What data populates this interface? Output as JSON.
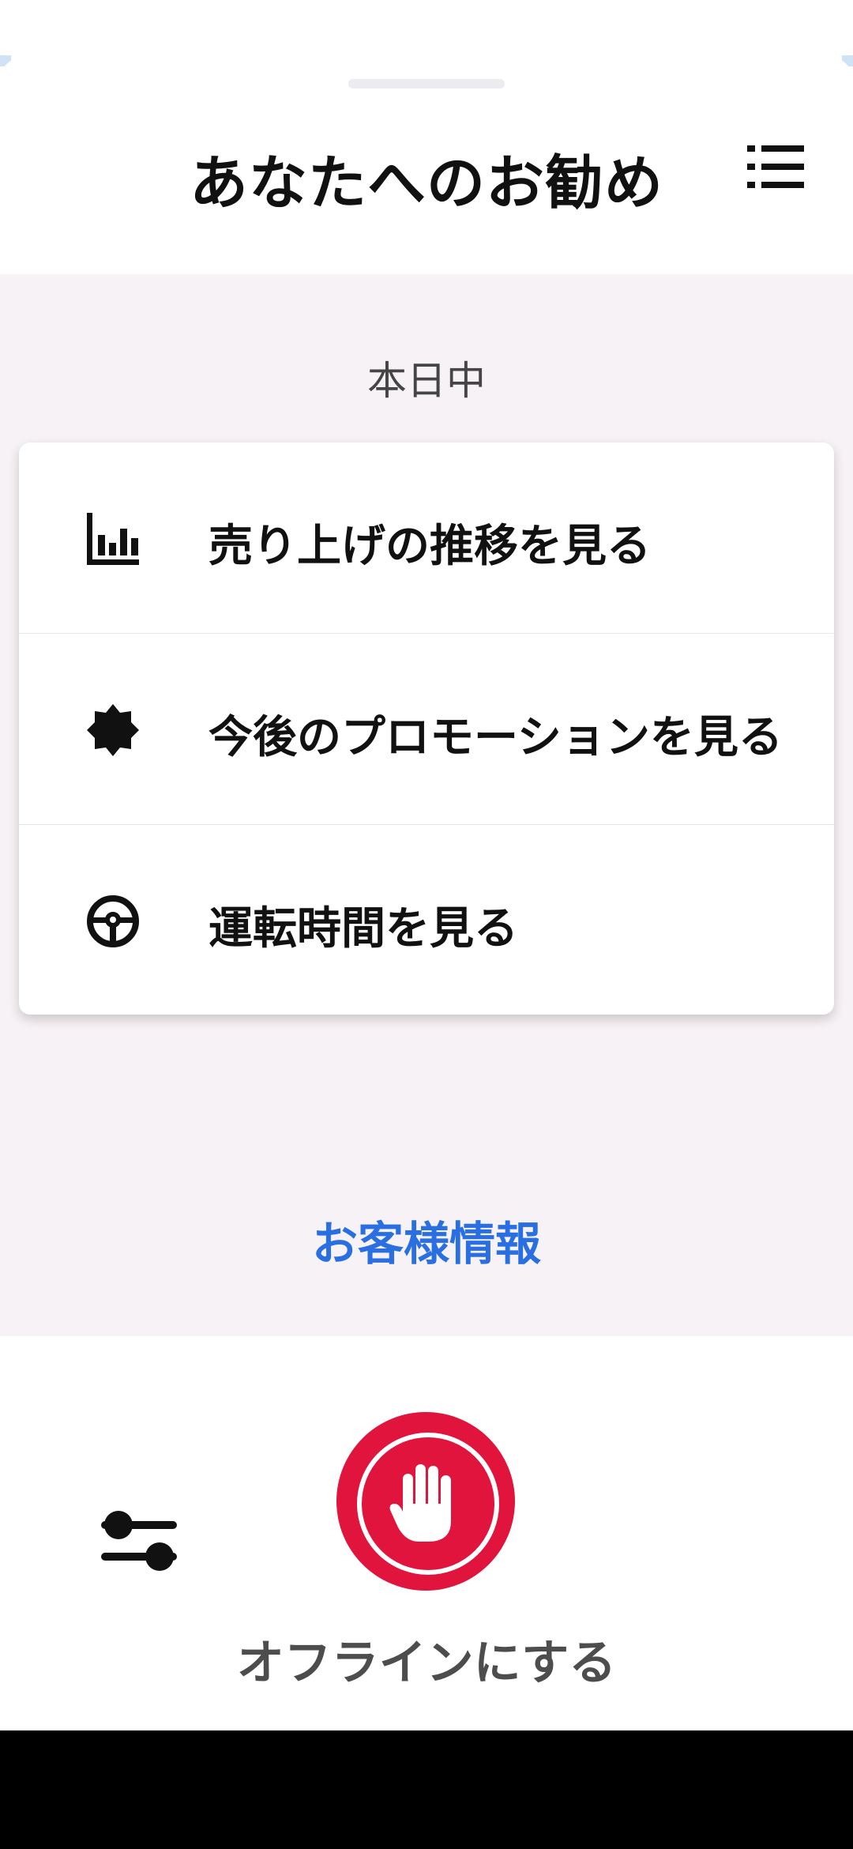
{
  "header": {
    "title": "あなたへのお勧め",
    "menu_icon": "list-icon"
  },
  "section": {
    "label": "本日中"
  },
  "recommendations": [
    {
      "icon": "bar-chart-icon",
      "label": "売り上げの推移を見る"
    },
    {
      "icon": "promotion-badge-icon",
      "label": "今後のプロモーションを見る"
    },
    {
      "icon": "steering-wheel-icon",
      "label": "運転時間を見る"
    }
  ],
  "customer_link": {
    "label": "お客様情報",
    "color": "#2a6fe2"
  },
  "bottom_bar": {
    "filter_icon": "sliders-icon",
    "offline_icon": "hand-stop-icon",
    "offline_label": "オフラインにする",
    "offline_color": "#e0143c"
  },
  "colors": {
    "background_panel": "#f7f2f5",
    "text_primary": "#111111",
    "nav_bar": "#000000"
  }
}
